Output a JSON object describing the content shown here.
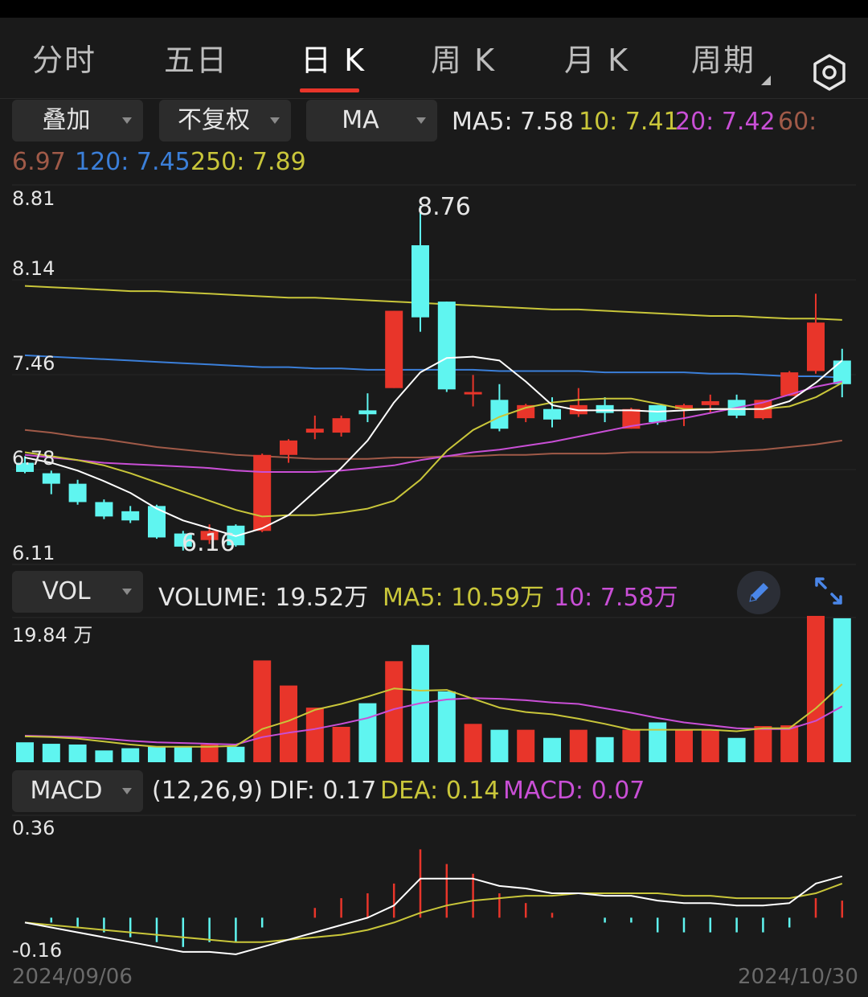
{
  "tabs": [
    "分时",
    "五日",
    "日 K",
    "周 K",
    "月 K",
    "周期"
  ],
  "active_tab": 2,
  "controls": {
    "overlay": "叠加",
    "adjust": "不复权",
    "ma": "MA",
    "vol": "VOL",
    "macd": "MACD"
  },
  "ma_legend": {
    "ma5": "MA5: 7.58",
    "ma10": "10: 7.41",
    "ma20": "20: 7.42",
    "ma60_label": "60:",
    "ma60_value": "6.97",
    "ma120": "120: 7.45",
    "ma250": "250: 7.89"
  },
  "vol_legend": {
    "volume": "VOLUME: 19.52万",
    "ma5": "MA5: 10.59万",
    "ma10": "10: 7.58万"
  },
  "macd_legend": {
    "params": "(12,26,9)",
    "dif": "DIF: 0.17",
    "dea": "DEA: 0.14",
    "macd": "MACD: 0.07"
  },
  "colors": {
    "up": "#e8352a",
    "down": "#5ff5f0",
    "ma5": "#ffffff",
    "ma10": "#c9c63a",
    "ma20": "#c94fd6",
    "ma60": "#a05a48",
    "ma120": "#3b7fd9",
    "ma250": "#c9c63a"
  },
  "chart_data": {
    "type": "candlestick",
    "price_axis": {
      "ticks": [
        "8.81",
        "8.14",
        "7.46",
        "6.78",
        "6.11"
      ],
      "ylim": [
        6.11,
        8.81
      ]
    },
    "annotations": {
      "high": "8.76",
      "low": "6.16"
    },
    "candles": [
      {
        "o": 6.8,
        "c": 6.73,
        "h": 6.85,
        "l": 6.72
      },
      {
        "o": 6.72,
        "c": 6.64,
        "h": 6.74,
        "l": 6.56
      },
      {
        "o": 6.64,
        "c": 6.5,
        "h": 6.67,
        "l": 6.48
      },
      {
        "o": 6.5,
        "c": 6.39,
        "h": 6.52,
        "l": 6.37
      },
      {
        "o": 6.43,
        "c": 6.36,
        "h": 6.47,
        "l": 6.34
      },
      {
        "o": 6.47,
        "c": 6.23,
        "h": 6.48,
        "l": 6.22
      },
      {
        "o": 6.26,
        "c": 6.16,
        "h": 6.28,
        "l": 6.13
      },
      {
        "o": 6.21,
        "c": 6.28,
        "h": 6.33,
        "l": 6.18
      },
      {
        "o": 6.32,
        "c": 6.17,
        "h": 6.33,
        "l": 6.16
      },
      {
        "o": 6.28,
        "c": 6.86,
        "h": 6.87,
        "l": 6.27
      },
      {
        "o": 6.86,
        "c": 6.97,
        "h": 6.98,
        "l": 6.8
      },
      {
        "o": 7.03,
        "c": 7.06,
        "h": 7.16,
        "l": 6.98
      },
      {
        "o": 7.03,
        "c": 7.14,
        "h": 7.16,
        "l": 7.0
      },
      {
        "o": 7.2,
        "c": 7.17,
        "h": 7.33,
        "l": 7.11
      },
      {
        "o": 7.37,
        "c": 7.96,
        "h": 7.96,
        "l": 7.37
      },
      {
        "o": 8.46,
        "c": 7.91,
        "h": 8.76,
        "l": 7.8
      },
      {
        "o": 8.03,
        "c": 7.36,
        "h": 8.03,
        "l": 7.34
      },
      {
        "o": 7.34,
        "c": 7.34,
        "h": 7.47,
        "l": 7.23
      },
      {
        "o": 7.28,
        "c": 7.06,
        "h": 7.4,
        "l": 7.04
      },
      {
        "o": 7.14,
        "c": 7.24,
        "h": 7.25,
        "l": 7.11
      },
      {
        "o": 7.21,
        "c": 7.13,
        "h": 7.3,
        "l": 7.07
      },
      {
        "o": 7.17,
        "c": 7.24,
        "h": 7.37,
        "l": 7.15
      },
      {
        "o": 7.24,
        "c": 7.18,
        "h": 7.3,
        "l": 7.11
      },
      {
        "o": 7.06,
        "c": 7.21,
        "h": 7.22,
        "l": 7.06
      },
      {
        "o": 7.24,
        "c": 7.11,
        "h": 7.24,
        "l": 7.09
      },
      {
        "o": 7.21,
        "c": 7.24,
        "h": 7.25,
        "l": 7.08
      },
      {
        "o": 7.24,
        "c": 7.27,
        "h": 7.32,
        "l": 7.18
      },
      {
        "o": 7.28,
        "c": 7.16,
        "h": 7.32,
        "l": 7.14
      },
      {
        "o": 7.14,
        "c": 7.28,
        "h": 7.28,
        "l": 7.13
      },
      {
        "o": 7.31,
        "c": 7.49,
        "h": 7.5,
        "l": 7.31
      },
      {
        "o": 7.5,
        "c": 7.87,
        "h": 8.09,
        "l": 7.48
      },
      {
        "o": 7.58,
        "c": 7.4,
        "h": 7.67,
        "l": 7.3
      }
    ],
    "ma5": [
      6.84,
      6.8,
      6.74,
      6.66,
      6.57,
      6.45,
      6.36,
      6.3,
      6.24,
      6.3,
      6.4,
      6.58,
      6.76,
      6.97,
      7.26,
      7.49,
      7.6,
      7.61,
      7.58,
      7.42,
      7.24,
      7.2,
      7.2,
      7.2,
      7.19,
      7.2,
      7.21,
      7.21,
      7.21,
      7.27,
      7.41,
      7.58
    ],
    "ma10": [
      6.88,
      6.85,
      6.82,
      6.78,
      6.72,
      6.65,
      6.58,
      6.51,
      6.44,
      6.39,
      6.4,
      6.4,
      6.42,
      6.45,
      6.51,
      6.67,
      6.89,
      7.05,
      7.15,
      7.22,
      7.26,
      7.28,
      7.29,
      7.29,
      7.25,
      7.21,
      7.21,
      7.21,
      7.21,
      7.23,
      7.3,
      7.41
    ],
    "ma20": [
      6.86,
      6.84,
      6.82,
      6.8,
      6.79,
      6.78,
      6.77,
      6.76,
      6.74,
      6.73,
      6.73,
      6.73,
      6.74,
      6.76,
      6.78,
      6.82,
      6.85,
      6.88,
      6.9,
      6.93,
      6.96,
      7.0,
      7.04,
      7.08,
      7.11,
      7.14,
      7.18,
      7.22,
      7.26,
      7.32,
      7.38,
      7.42
    ],
    "ma60": [
      7.05,
      7.03,
      7.0,
      6.98,
      6.95,
      6.92,
      6.9,
      6.88,
      6.86,
      6.85,
      6.84,
      6.83,
      6.83,
      6.83,
      6.84,
      6.84,
      6.85,
      6.85,
      6.86,
      6.86,
      6.87,
      6.87,
      6.87,
      6.88,
      6.88,
      6.88,
      6.88,
      6.89,
      6.9,
      6.92,
      6.94,
      6.97
    ],
    "ma120": [
      7.62,
      7.61,
      7.6,
      7.59,
      7.58,
      7.57,
      7.56,
      7.55,
      7.54,
      7.53,
      7.53,
      7.52,
      7.52,
      7.51,
      7.51,
      7.51,
      7.51,
      7.51,
      7.5,
      7.5,
      7.5,
      7.5,
      7.49,
      7.49,
      7.49,
      7.49,
      7.48,
      7.48,
      7.47,
      7.46,
      7.46,
      7.45
    ],
    "ma250": [
      8.15,
      8.14,
      8.13,
      8.12,
      8.11,
      8.11,
      8.1,
      8.09,
      8.08,
      8.07,
      8.06,
      8.06,
      8.05,
      8.04,
      8.03,
      8.02,
      8.01,
      8.0,
      7.99,
      7.98,
      7.97,
      7.97,
      7.96,
      7.95,
      7.94,
      7.93,
      7.92,
      7.92,
      7.91,
      7.9,
      7.9,
      7.89
    ],
    "volume_axis": {
      "max_label": "19.84 万",
      "max": 19.84
    },
    "volume": [
      2.7,
      2.5,
      2.4,
      1.6,
      1.9,
      2.1,
      2.1,
      2.4,
      2.1,
      13.8,
      10.4,
      7.4,
      4.8,
      8.0,
      13.7,
      15.9,
      9.6,
      5.2,
      4.4,
      4.4,
      3.3,
      4.4,
      3.4,
      4.4,
      5.4,
      4.4,
      4.4,
      3.3,
      4.9,
      5.0,
      19.84,
      19.52
    ],
    "vol_ma5": [
      3.5,
      3.4,
      3.2,
      2.8,
      2.4,
      2.1,
      2.1,
      2.1,
      2.2,
      4.5,
      5.6,
      7.1,
      7.9,
      8.9,
      10.0,
      9.7,
      9.8,
      8.6,
      7.4,
      6.8,
      6.5,
      5.9,
      5.2,
      4.4,
      4.4,
      4.4,
      4.4,
      4.2,
      4.6,
      4.6,
      7.3,
      10.59
    ],
    "vol_ma10": [
      3.6,
      3.5,
      3.4,
      3.2,
      2.9,
      2.7,
      2.6,
      2.5,
      2.4,
      3.4,
      4.0,
      4.5,
      5.2,
      6.0,
      7.2,
      8.0,
      8.5,
      8.7,
      8.6,
      8.4,
      8.1,
      7.9,
      7.3,
      6.7,
      6.0,
      5.4,
      5.0,
      4.6,
      4.5,
      4.5,
      5.6,
      7.58
    ],
    "macd_axis": {
      "ticks": [
        "0.36",
        "-0.16"
      ],
      "ylim": [
        -0.18,
        0.4
      ]
    },
    "dif": [
      -0.02,
      -0.04,
      -0.06,
      -0.08,
      -0.1,
      -0.12,
      -0.14,
      -0.14,
      -0.15,
      -0.12,
      -0.09,
      -0.06,
      -0.03,
      0.0,
      0.05,
      0.16,
      0.16,
      0.16,
      0.13,
      0.12,
      0.1,
      0.1,
      0.09,
      0.09,
      0.07,
      0.06,
      0.06,
      0.05,
      0.05,
      0.06,
      0.14,
      0.17
    ],
    "dea": [
      -0.02,
      -0.03,
      -0.04,
      -0.05,
      -0.06,
      -0.07,
      -0.08,
      -0.09,
      -0.1,
      -0.1,
      -0.09,
      -0.08,
      -0.07,
      -0.05,
      -0.02,
      0.02,
      0.05,
      0.07,
      0.08,
      0.09,
      0.09,
      0.1,
      0.1,
      0.1,
      0.1,
      0.09,
      0.09,
      0.08,
      0.08,
      0.08,
      0.1,
      0.14
    ],
    "macd": [
      0.0,
      -0.02,
      -0.04,
      -0.06,
      -0.08,
      -0.1,
      -0.12,
      -0.1,
      -0.1,
      -0.04,
      0.0,
      0.04,
      0.08,
      0.1,
      0.14,
      0.28,
      0.22,
      0.18,
      0.1,
      0.06,
      0.02,
      0.0,
      -0.02,
      -0.02,
      -0.06,
      -0.06,
      -0.06,
      -0.06,
      -0.06,
      -0.04,
      0.08,
      0.07
    ],
    "dates": [
      "2024/09/06",
      "2024/10/30"
    ]
  }
}
